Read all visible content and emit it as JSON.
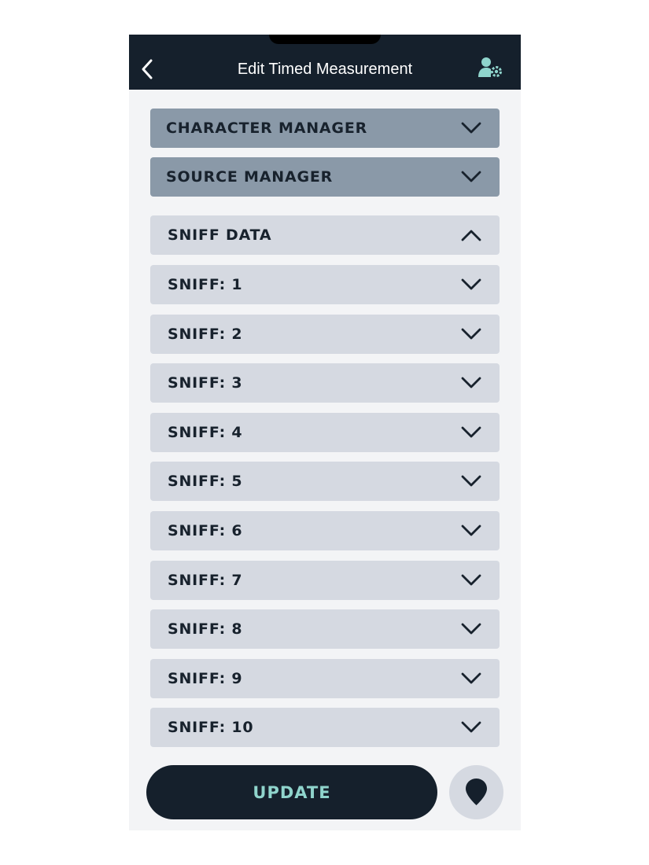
{
  "header": {
    "title": "Edit Timed Measurement",
    "back_icon": "chevron-left-icon",
    "user_icon": "user-settings-icon"
  },
  "managers": [
    {
      "label": "CHARACTER MANAGER",
      "expanded": false
    },
    {
      "label": "SOURCE MANAGER",
      "expanded": false
    }
  ],
  "sniff_data": {
    "label": "SNIFF DATA",
    "expanded": true
  },
  "sniffs": [
    {
      "label": "SNIFF: 1"
    },
    {
      "label": "SNIFF: 2"
    },
    {
      "label": "SNIFF: 3"
    },
    {
      "label": "SNIFF: 4"
    },
    {
      "label": "SNIFF: 5"
    },
    {
      "label": "SNIFF: 6"
    },
    {
      "label": "SNIFF: 7"
    },
    {
      "label": "SNIFF: 8"
    },
    {
      "label": "SNIFF: 9"
    },
    {
      "label": "SNIFF: 10"
    }
  ],
  "footer": {
    "update_label": "UPDATE",
    "location_icon": "map-pin-icon"
  },
  "colors": {
    "header_bg": "#15202c",
    "manager_bg": "#8a99a8",
    "row_bg": "#d5d9e1",
    "accent": "#8fd4cc",
    "page_bg": "#f3f4f6"
  }
}
